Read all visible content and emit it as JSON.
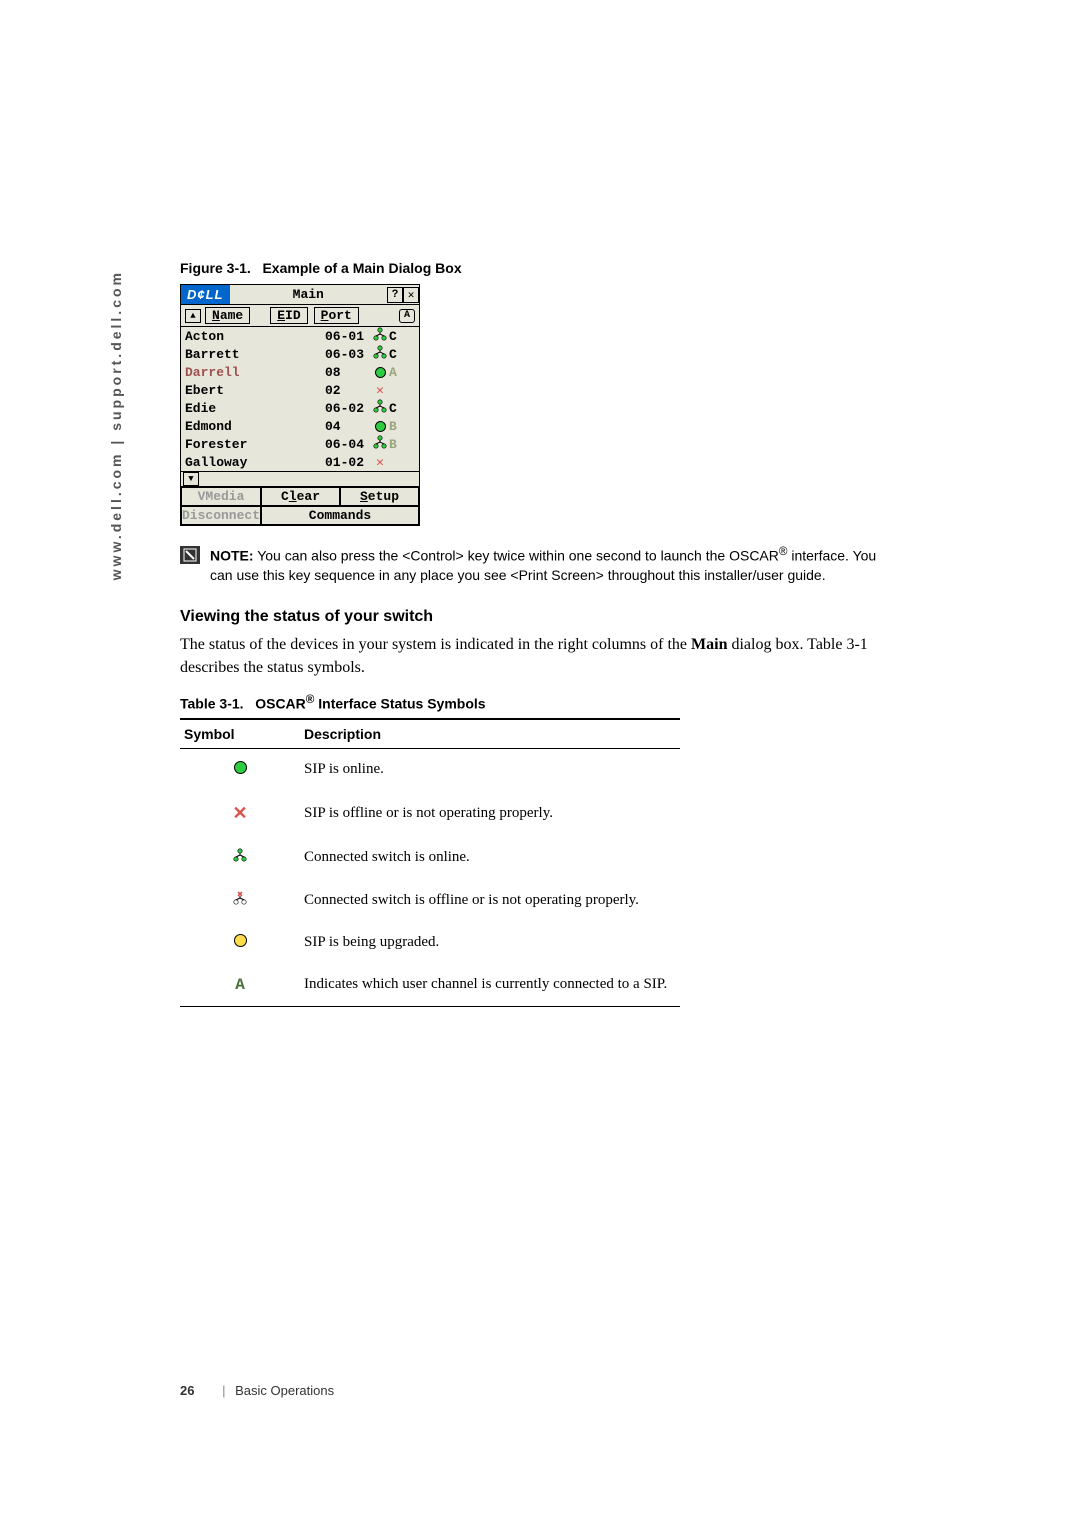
{
  "sidebar_url": "www.dell.com | support.dell.com",
  "figure_caption_label": "Figure 3-1.",
  "figure_caption_text": "Example of a Main Dialog Box",
  "dialog": {
    "logo": "D¢LL",
    "title": "Main",
    "help_btn": "?",
    "close_btn": "✕",
    "headers": {
      "sort": "▲",
      "name_u": "N",
      "name_rest": "ame",
      "eid_u": "E",
      "eid_rest": "ID",
      "port_u": "P",
      "port_rest": "ort",
      "indicator": "A"
    },
    "rows": [
      {
        "name": "Acton",
        "name_red": false,
        "port": "06-01",
        "icon": "tree-green",
        "letter": "C",
        "dim": false
      },
      {
        "name": "Barrett",
        "name_red": false,
        "port": "06-03",
        "icon": "tree-green",
        "letter": "C",
        "dim": false
      },
      {
        "name": "Darrell",
        "name_red": true,
        "port": "08",
        "icon": "circle-green",
        "letter": "A",
        "dim": true
      },
      {
        "name": "Ebert",
        "name_red": false,
        "port": "02",
        "icon": "x",
        "letter": "",
        "dim": false
      },
      {
        "name": "Edie",
        "name_red": false,
        "port": "06-02",
        "icon": "tree-green",
        "letter": "C",
        "dim": false
      },
      {
        "name": "Edmond",
        "name_red": false,
        "port": "04",
        "icon": "circle-green",
        "letter": "B",
        "dim": true
      },
      {
        "name": "Forester",
        "name_red": false,
        "port": "06-04",
        "icon": "tree-green",
        "letter": "B",
        "dim": true
      },
      {
        "name": "Galloway",
        "name_red": false,
        "port": "01-02",
        "icon": "x",
        "letter": "",
        "dim": false
      }
    ],
    "scroll_down": "▼",
    "buttons": {
      "vmedia": "VMedia",
      "clear_u": "l",
      "clear_pre": "C",
      "clear_post": "ear",
      "setup_u": "S",
      "setup_post": "etup",
      "disconnect": "Disconnect",
      "commands": "Commands"
    }
  },
  "note": {
    "label": "NOTE:",
    "line1a": "You can also press the <Control> key twice within one second to launch the OSCAR",
    "reg": "®",
    "line2": "interface. You can use this key sequence in any place you see <Print Screen> throughout this installer/user guide."
  },
  "section_header": "Viewing the status of your switch",
  "paragraph_a": "The status of the devices in your system is indicated in the right columns of the ",
  "paragraph_main": "Main",
  "paragraph_b": " dialog box. Table 3-1 describes the status symbols.",
  "table_caption_label": "Table 3-1.",
  "table_caption_a": "OSCAR",
  "table_reg": "®",
  "table_caption_b": " Interface Status Symbols",
  "table_headers": {
    "symbol": "Symbol",
    "desc": "Description"
  },
  "status_rows": [
    {
      "sym": "circle-green",
      "desc": "SIP is online."
    },
    {
      "sym": "x",
      "desc": "SIP is offline or is not operating properly."
    },
    {
      "sym": "tree-green",
      "desc": "Connected switch is online."
    },
    {
      "sym": "tree-x",
      "desc": "Connected switch is offline or is not operating properly."
    },
    {
      "sym": "circle-yellow",
      "desc": "SIP is being upgraded."
    },
    {
      "sym": "user-a",
      "desc": "Indicates which user channel is currently connected to a SIP."
    }
  ],
  "footer_page": "26",
  "footer_section": "Basic Operations"
}
